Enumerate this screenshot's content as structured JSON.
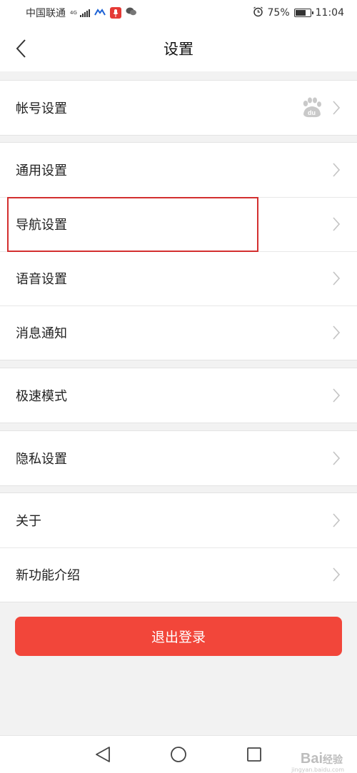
{
  "status_bar": {
    "carrier": "中国联通",
    "network": "4G",
    "battery_percent": "75%",
    "battery_level": 0.75,
    "time": "11:04"
  },
  "header": {
    "title": "设置"
  },
  "groups": [
    {
      "items": [
        {
          "label": "帐号设置",
          "extra_icon": "baidu-paw-icon"
        }
      ]
    },
    {
      "items": [
        {
          "label": "通用设置"
        },
        {
          "label": "导航设置"
        },
        {
          "label": "语音设置"
        },
        {
          "label": "消息通知"
        }
      ]
    },
    {
      "items": [
        {
          "label": "极速模式"
        }
      ]
    },
    {
      "items": [
        {
          "label": "隐私设置"
        }
      ]
    },
    {
      "items": [
        {
          "label": "关于"
        },
        {
          "label": "新功能介绍"
        }
      ]
    }
  ],
  "logout": {
    "label": "退出登录"
  },
  "watermark": {
    "brand": "Bai",
    "brand_cn": "经验",
    "url": "jingyan.baidu.com"
  },
  "colors": {
    "accent": "#f2463a",
    "highlight": "#d32f2f"
  }
}
